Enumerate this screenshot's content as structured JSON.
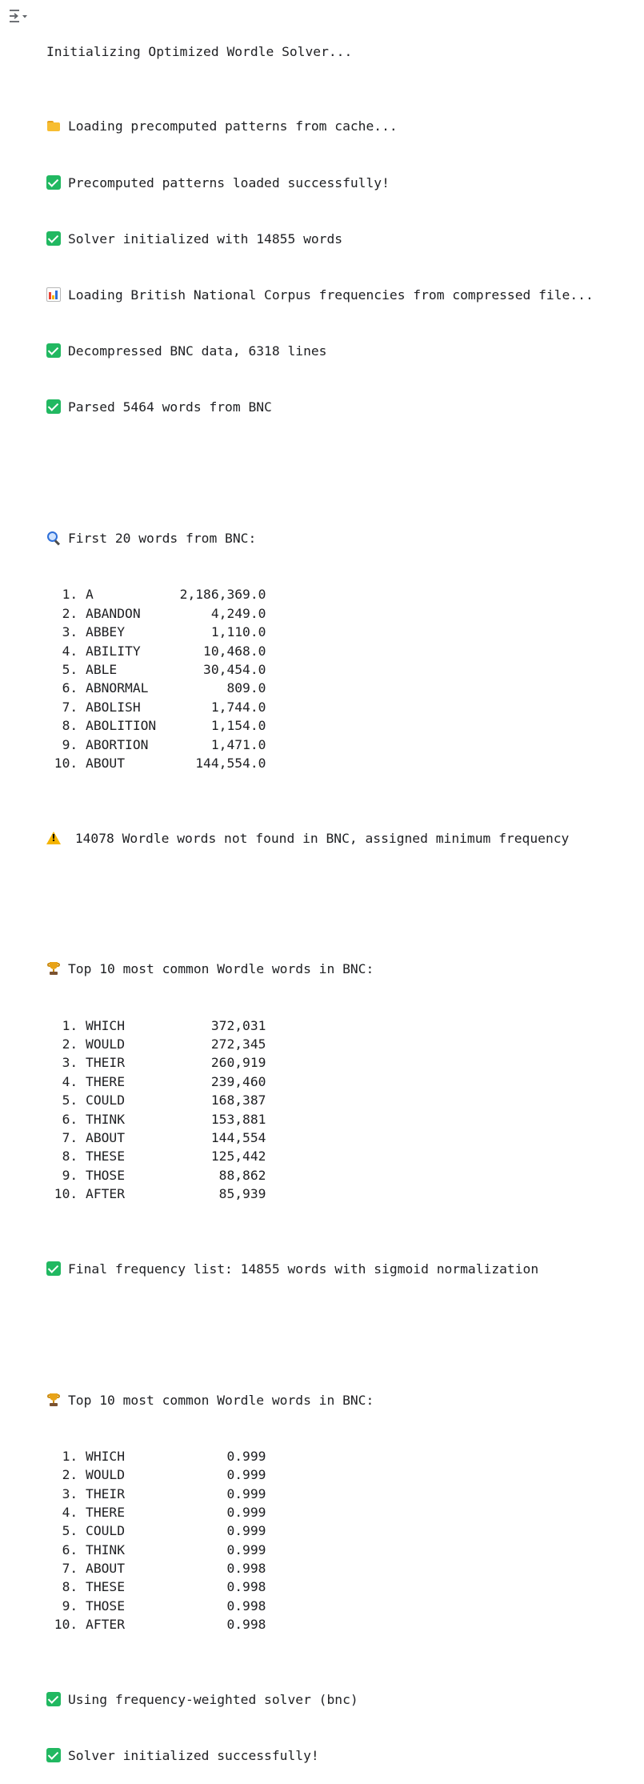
{
  "cell_output": {
    "title": "Initializing Optimized Wordle Solver...",
    "loading_patterns": "Loading precomputed patterns from cache...",
    "patterns_loaded": "Precomputed patterns loaded successfully!",
    "solver_words": "Solver initialized with 14855 words",
    "loading_bnc": "Loading British National Corpus frequencies from compressed file...",
    "decompressed": "Decompressed BNC data, 6318 lines",
    "parsed": "Parsed 5464 words from BNC",
    "first_20_heading": "First 20 words from BNC:",
    "first_20": [
      {
        "rank": "1.",
        "word": "A",
        "value": "2,186,369.0"
      },
      {
        "rank": "2.",
        "word": "ABANDON",
        "value": "4,249.0"
      },
      {
        "rank": "3.",
        "word": "ABBEY",
        "value": "1,110.0"
      },
      {
        "rank": "4.",
        "word": "ABILITY",
        "value": "10,468.0"
      },
      {
        "rank": "5.",
        "word": "ABLE",
        "value": "30,454.0"
      },
      {
        "rank": "6.",
        "word": "ABNORMAL",
        "value": "809.0"
      },
      {
        "rank": "7.",
        "word": "ABOLISH",
        "value": "1,744.0"
      },
      {
        "rank": "8.",
        "word": "ABOLITION",
        "value": "1,154.0"
      },
      {
        "rank": "9.",
        "word": "ABORTION",
        "value": "1,471.0"
      },
      {
        "rank": "10.",
        "word": "ABOUT",
        "value": "144,554.0"
      }
    ],
    "not_found_warning": "14078 Wordle words not found in BNC, assigned minimum frequency",
    "top10_heading": "Top 10 most common Wordle words in BNC:",
    "top10_counts": [
      {
        "rank": "1.",
        "word": "WHICH",
        "value": "372,031"
      },
      {
        "rank": "2.",
        "word": "WOULD",
        "value": "272,345"
      },
      {
        "rank": "3.",
        "word": "THEIR",
        "value": "260,919"
      },
      {
        "rank": "4.",
        "word": "THERE",
        "value": "239,460"
      },
      {
        "rank": "5.",
        "word": "COULD",
        "value": "168,387"
      },
      {
        "rank": "6.",
        "word": "THINK",
        "value": "153,881"
      },
      {
        "rank": "7.",
        "word": "ABOUT",
        "value": "144,554"
      },
      {
        "rank": "8.",
        "word": "THESE",
        "value": "125,442"
      },
      {
        "rank": "9.",
        "word": "THOSE",
        "value": "88,862"
      },
      {
        "rank": "10.",
        "word": "AFTER",
        "value": "85,939"
      }
    ],
    "final_list": "Final frequency list: 14855 words with sigmoid normalization",
    "top10_heading_2": "Top 10 most common Wordle words in BNC:",
    "top10_normalized": [
      {
        "rank": "1.",
        "word": "WHICH",
        "value": "0.999"
      },
      {
        "rank": "2.",
        "word": "WOULD",
        "value": "0.999"
      },
      {
        "rank": "3.",
        "word": "THEIR",
        "value": "0.999"
      },
      {
        "rank": "4.",
        "word": "THERE",
        "value": "0.999"
      },
      {
        "rank": "5.",
        "word": "COULD",
        "value": "0.999"
      },
      {
        "rank": "6.",
        "word": "THINK",
        "value": "0.999"
      },
      {
        "rank": "7.",
        "word": "ABOUT",
        "value": "0.998"
      },
      {
        "rank": "8.",
        "word": "THESE",
        "value": "0.998"
      },
      {
        "rank": "9.",
        "word": "THOSE",
        "value": "0.998"
      },
      {
        "rank": "10.",
        "word": "AFTER",
        "value": "0.998"
      }
    ],
    "using_solver": "Using frequency-weighted solver (bnc)",
    "solver_done": "Solver initialized successfully!"
  },
  "icons": {
    "toggle": "output-toggle-icon",
    "check": "check-mark-icon",
    "folder": "folder-icon",
    "chart": "bar-chart-icon",
    "search": "magnifying-glass-icon",
    "warning": "warning-icon",
    "trophy": "trophy-icon"
  },
  "colors": {
    "check_green": "#21b861",
    "text": "#202124",
    "folder": "#f7bd31",
    "warning": "#f5b400",
    "trophy": "#e8a317",
    "magnifier": "#2e6fd8"
  }
}
